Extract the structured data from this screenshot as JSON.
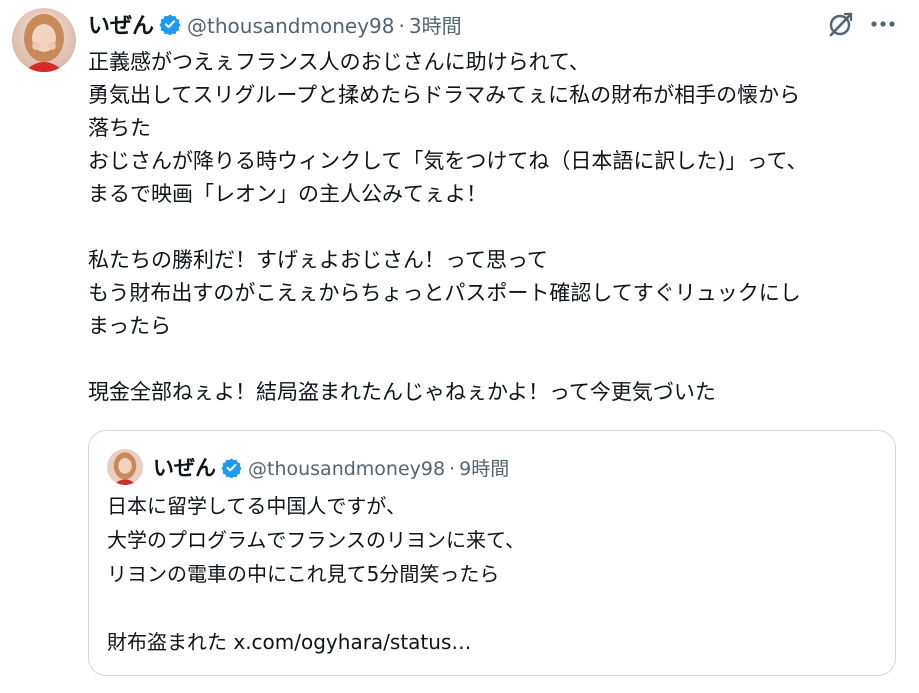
{
  "tweet": {
    "display_name": "いぜん",
    "handle": "@thousandmoney98",
    "separator": "·",
    "time": "3時間",
    "text": "正義感がつえぇフランス人のおじさんに助けられて、\n勇気出してスリグループと揉めたらドラマみてぇに私の財布が相手の懐から\n落ちた\nおじさんが降りる時ウィンクして「気をつけてね（日本語に訳した)」って、\nまるで映画「レオン」の主人公みてぇよ！\n\n私たちの勝利だ！すげぇよおじさん！って思って\nもう財布出すのがこえぇからちょっとパスポート確認してすぐリュックにし\nまったら\n\n現金全部ねぇよ！結局盗まれたんじゃねぇかよ！って今更気づいた"
  },
  "quoted_tweet": {
    "display_name": "いぜん",
    "handle": "@thousandmoney98",
    "separator": "·",
    "time": "9時間",
    "text": "日本に留学してる中国人ですが、\n大学のプログラムでフランスのリヨンに来て、\nリヨンの電車の中にこれ見て5分間笑ったら\n\n財布盗まれた x.com/ogyhara/status…"
  },
  "icons": {
    "verified": "verified-badge-icon",
    "grok": "grok-icon",
    "more": "more-options-icon"
  },
  "colors": {
    "text": "#0f1419",
    "secondary": "#536471",
    "verified_blue": "#1d9bf0",
    "border": "#cfd9de"
  }
}
